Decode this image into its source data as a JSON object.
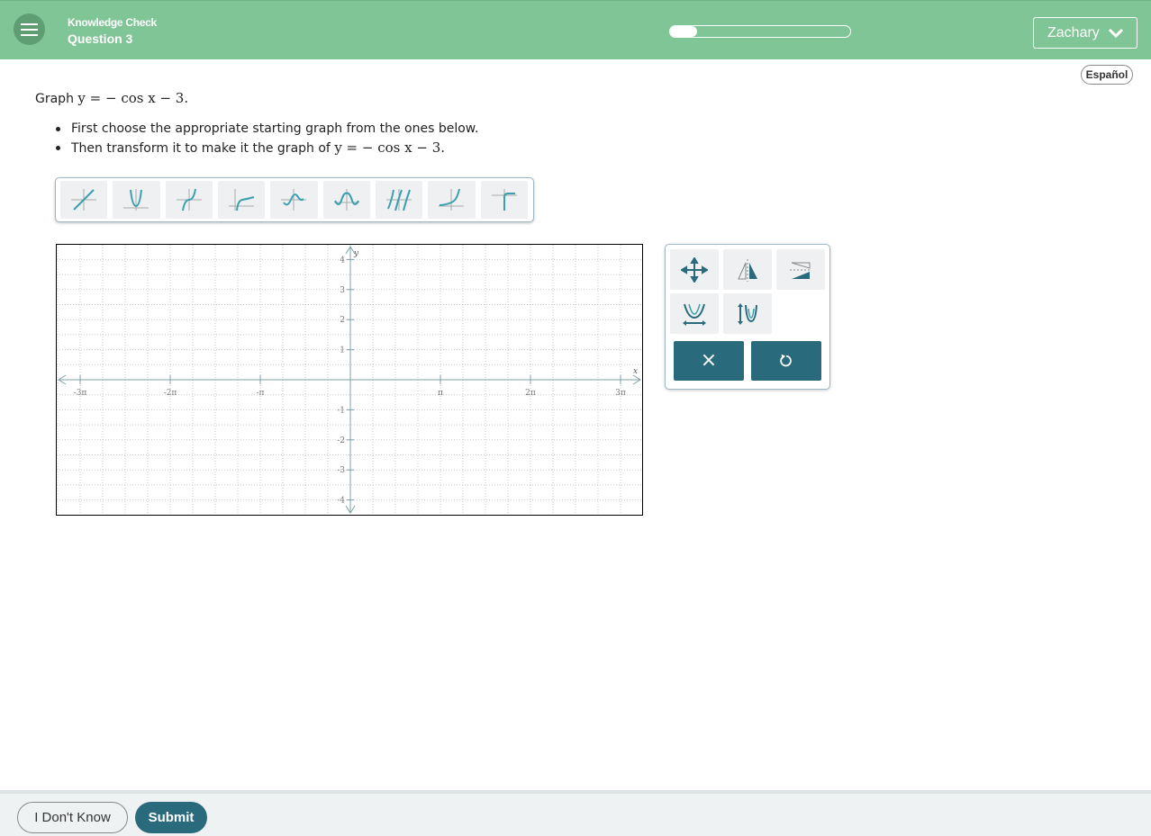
{
  "header": {
    "subtitle": "Knowledge Check",
    "question_label": "Question 3",
    "progress_fraction": 0.15,
    "user_name": "Zachary"
  },
  "language_button": "Español",
  "question": {
    "prompt_prefix": "Graph",
    "equation": "y = − cos x − 3.",
    "bullets": [
      "First choose the appropriate starting graph from the ones below.",
      "Then transform it to make it the graph of"
    ],
    "bullet_equation": "y = − cos x − 3."
  },
  "parent_functions": [
    "linear-icon",
    "abs-or-parabola-icon",
    "cubic-icon",
    "log-icon",
    "sine-icon",
    "cosine-icon",
    "tangent-icon",
    "exponential-icon",
    "sqrt-icon"
  ],
  "graph": {
    "x_axis_label": "x",
    "y_axis_label": "y",
    "x_tick_labels": [
      "-3π",
      "-2π",
      "-π",
      "π",
      "2π",
      "3π"
    ],
    "y_tick_labels": [
      "4",
      "3",
      "2",
      "1",
      "-1",
      "-2",
      "-3",
      "-4"
    ]
  },
  "tools": {
    "move": "move-icon",
    "reflect_vertical": "reflect-y-icon",
    "reflect_horizontal": "reflect-x-icon",
    "stretch_horizontal": "horizontal-stretch-icon",
    "stretch_vertical": "vertical-stretch-icon",
    "clear": "×",
    "undo": "undo-icon"
  },
  "footer": {
    "dont_know": "I Don't Know",
    "submit": "Submit"
  },
  "colors": {
    "header": "#80c595",
    "accent": "#2a6a7d",
    "icon": "#3aa0b0"
  }
}
